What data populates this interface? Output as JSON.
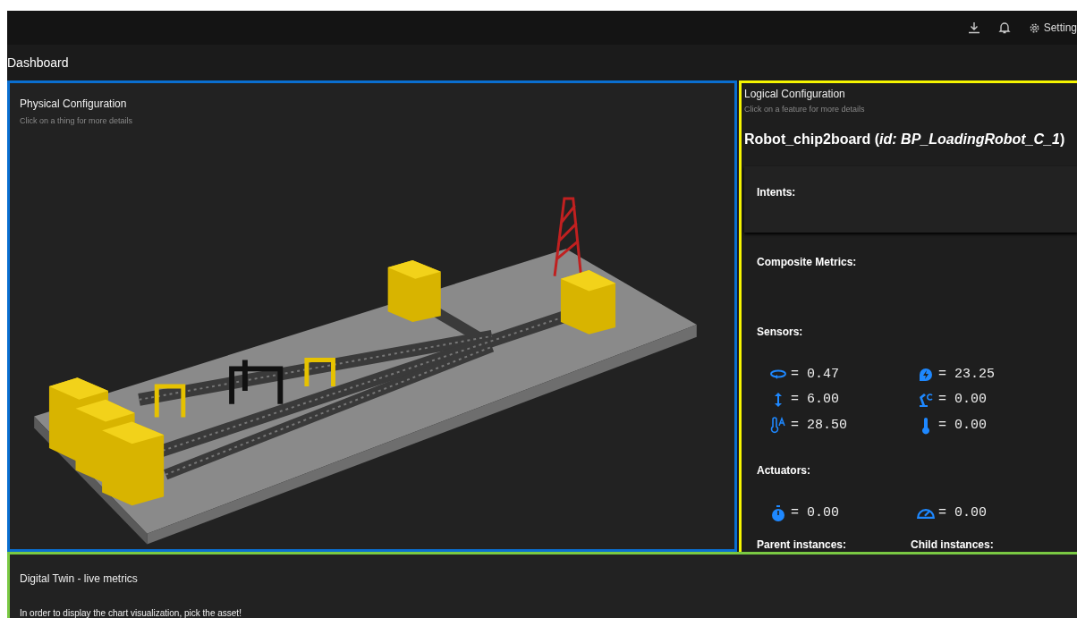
{
  "topbar": {
    "settings_label": "Setting"
  },
  "page_title": "Dashboard",
  "physical": {
    "title": "Physical Configuration",
    "subtitle": "Click on a thing for more details"
  },
  "logical": {
    "title": "Logical Configuration",
    "subtitle": "Click on a feature for more details",
    "asset": "Robot_chip2board (*id: BP_LoadingRobot_C_1*)",
    "sections": [
      {
        "title": "Intents:",
        "kind": "empty"
      },
      {
        "title": "Composite Metrics:",
        "kind": "empty"
      },
      {
        "title": "Sensors:",
        "kind": "metrics",
        "items": [
          {
            "kind": "rotation",
            "text": "= 0.47"
          },
          {
            "kind": "energy",
            "text": "= 23.25"
          },
          {
            "kind": "height",
            "text": "= 6.00"
          },
          {
            "kind": "robot-arm",
            "text": "= 0.00"
          },
          {
            "kind": "temperature-a",
            "text": "= 28.50"
          },
          {
            "kind": "thermometer",
            "text": "= 0.00"
          }
        ]
      },
      {
        "title": "Actuators:",
        "kind": "metrics",
        "items": [
          {
            "kind": "timer",
            "text": "= 0.00"
          },
          {
            "kind": "gauge",
            "text": "= 0.00"
          }
        ]
      }
    ],
    "instances": [
      "Parent instances:",
      "Child instances:"
    ]
  },
  "live": {
    "title": "Digital Twin - live metrics",
    "message": "In order to display the chart visualization, pick the asset!"
  }
}
